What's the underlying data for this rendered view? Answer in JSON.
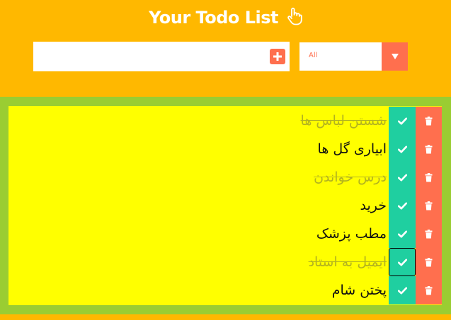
{
  "header": {
    "title": "Your Todo List",
    "hand_icon": "hand-pointer-icon"
  },
  "form": {
    "input_value": "",
    "add_icon": "plus-square-icon",
    "filter_selected": "All",
    "filter_arrow_icon": "caret-down-icon"
  },
  "todos": [
    {
      "text": "شستن لباس ها",
      "completed": true
    },
    {
      "text": "ابیاری گل ها",
      "completed": false
    },
    {
      "text": "درس خواندن",
      "completed": true
    },
    {
      "text": "خرید",
      "completed": false
    },
    {
      "text": "مطب پزشک",
      "completed": false
    },
    {
      "text": "ایمیل به استاد",
      "completed": true
    },
    {
      "text": "پختن شام",
      "completed": false
    }
  ],
  "colors": {
    "header_bg": "#FFB800",
    "list_band": "#9ACD32",
    "list_bg": "#FFFF00",
    "check": "#1FCFA0",
    "trash": "#FF6F4E"
  }
}
